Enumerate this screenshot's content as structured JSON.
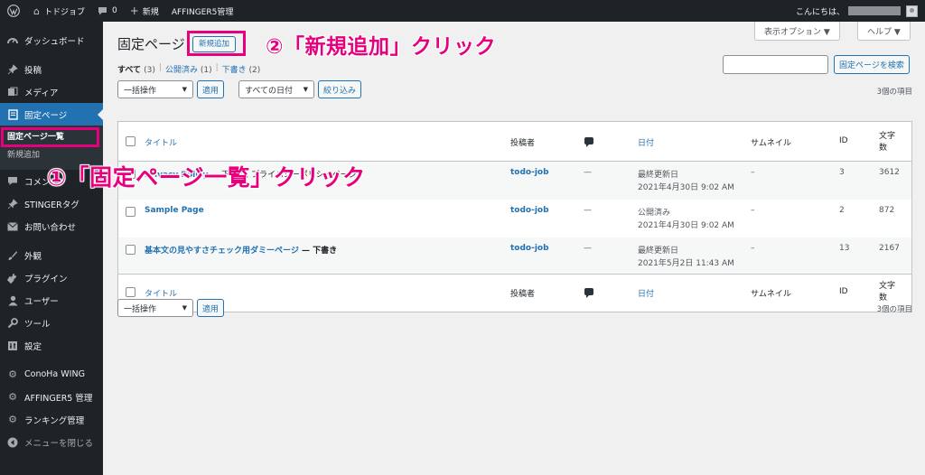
{
  "adminbar": {
    "site_name": "トドジョブ",
    "comments_count": "0",
    "new_label": "新規",
    "affinger_label": "AFFINGER5管理",
    "greeting": "こんにちは、"
  },
  "sidebar": {
    "items": [
      {
        "label": "ダッシュボード",
        "icon": "gauge-icon"
      },
      {
        "label": "投稿",
        "icon": "pin-icon"
      },
      {
        "label": "メディア",
        "icon": "media-icon"
      },
      {
        "label": "固定ページ",
        "icon": "page-icon"
      },
      {
        "label": "コメント",
        "icon": "comment-icon"
      },
      {
        "label": "STINGERタグ",
        "icon": "pin-icon"
      },
      {
        "label": "お問い合わせ",
        "icon": "mail-icon"
      },
      {
        "label": "外観",
        "icon": "brush-icon"
      },
      {
        "label": "プラグイン",
        "icon": "plug-icon"
      },
      {
        "label": "ユーザー",
        "icon": "user-icon"
      },
      {
        "label": "ツール",
        "icon": "wrench-icon"
      },
      {
        "label": "設定",
        "icon": "settings-icon"
      },
      {
        "label": "ConoHa WING",
        "icon": "gear-icon"
      },
      {
        "label": "AFFINGER5 管理",
        "icon": "gear-icon"
      },
      {
        "label": "ランキング管理",
        "icon": "gear-icon"
      },
      {
        "label": "メニューを閉じる",
        "icon": "collapse-icon"
      }
    ],
    "submenu": [
      "固定ページ一覧",
      "新規追加"
    ]
  },
  "header": {
    "title": "固定ページ",
    "add_new": "新規追加",
    "screen_options": "表示オプション ▼",
    "help": "ヘルプ ▼"
  },
  "views": {
    "all": "すべて",
    "all_count": "(3)",
    "publish": "公開済み",
    "publish_count": "(1)",
    "draft": "下書き",
    "draft_count": "(2)",
    "sep": "|"
  },
  "search": {
    "button": "固定ページを検索"
  },
  "actions": {
    "bulk": "一括操作",
    "apply": "適用",
    "dates": "すべての日付",
    "filter": "絞り込み",
    "items_count": "3個の項目"
  },
  "table": {
    "columns": {
      "title": "タイトル",
      "author": "投稿者",
      "date": "日付",
      "thumbnail": "サムネイル",
      "id": "ID",
      "chars": "文字数"
    },
    "rows": [
      {
        "title": "Privacy Policy",
        "state": " — 下書き, プライバシーポリシーページ",
        "author": "todo-job",
        "comments": "—",
        "date_status": "最終更新日",
        "date": "2021年4月30日 9:02 AM",
        "thumb": "–",
        "id": "3",
        "chars": "3612"
      },
      {
        "title": "Sample Page",
        "state": "",
        "author": "todo-job",
        "comments": "—",
        "date_status": "公開済み",
        "date": "2021年4月30日 9:02 AM",
        "thumb": "–",
        "id": "2",
        "chars": "872"
      },
      {
        "title": "基本文の見やすさチェック用ダミーページ",
        "state": " — 下書き",
        "author": "todo-job",
        "comments": "—",
        "date_status": "最終更新日",
        "date": "2021年5月2日 11:43 AM",
        "thumb": "–",
        "id": "13",
        "chars": "2167"
      }
    ]
  },
  "annotations": {
    "step2": "②「新規追加」クリック",
    "step1": "①「固定ページ一覧」クリック"
  },
  "colors": {
    "accent": "#2271b1",
    "annotation": "#e6007e",
    "sidebar_bg": "#1d2327"
  }
}
